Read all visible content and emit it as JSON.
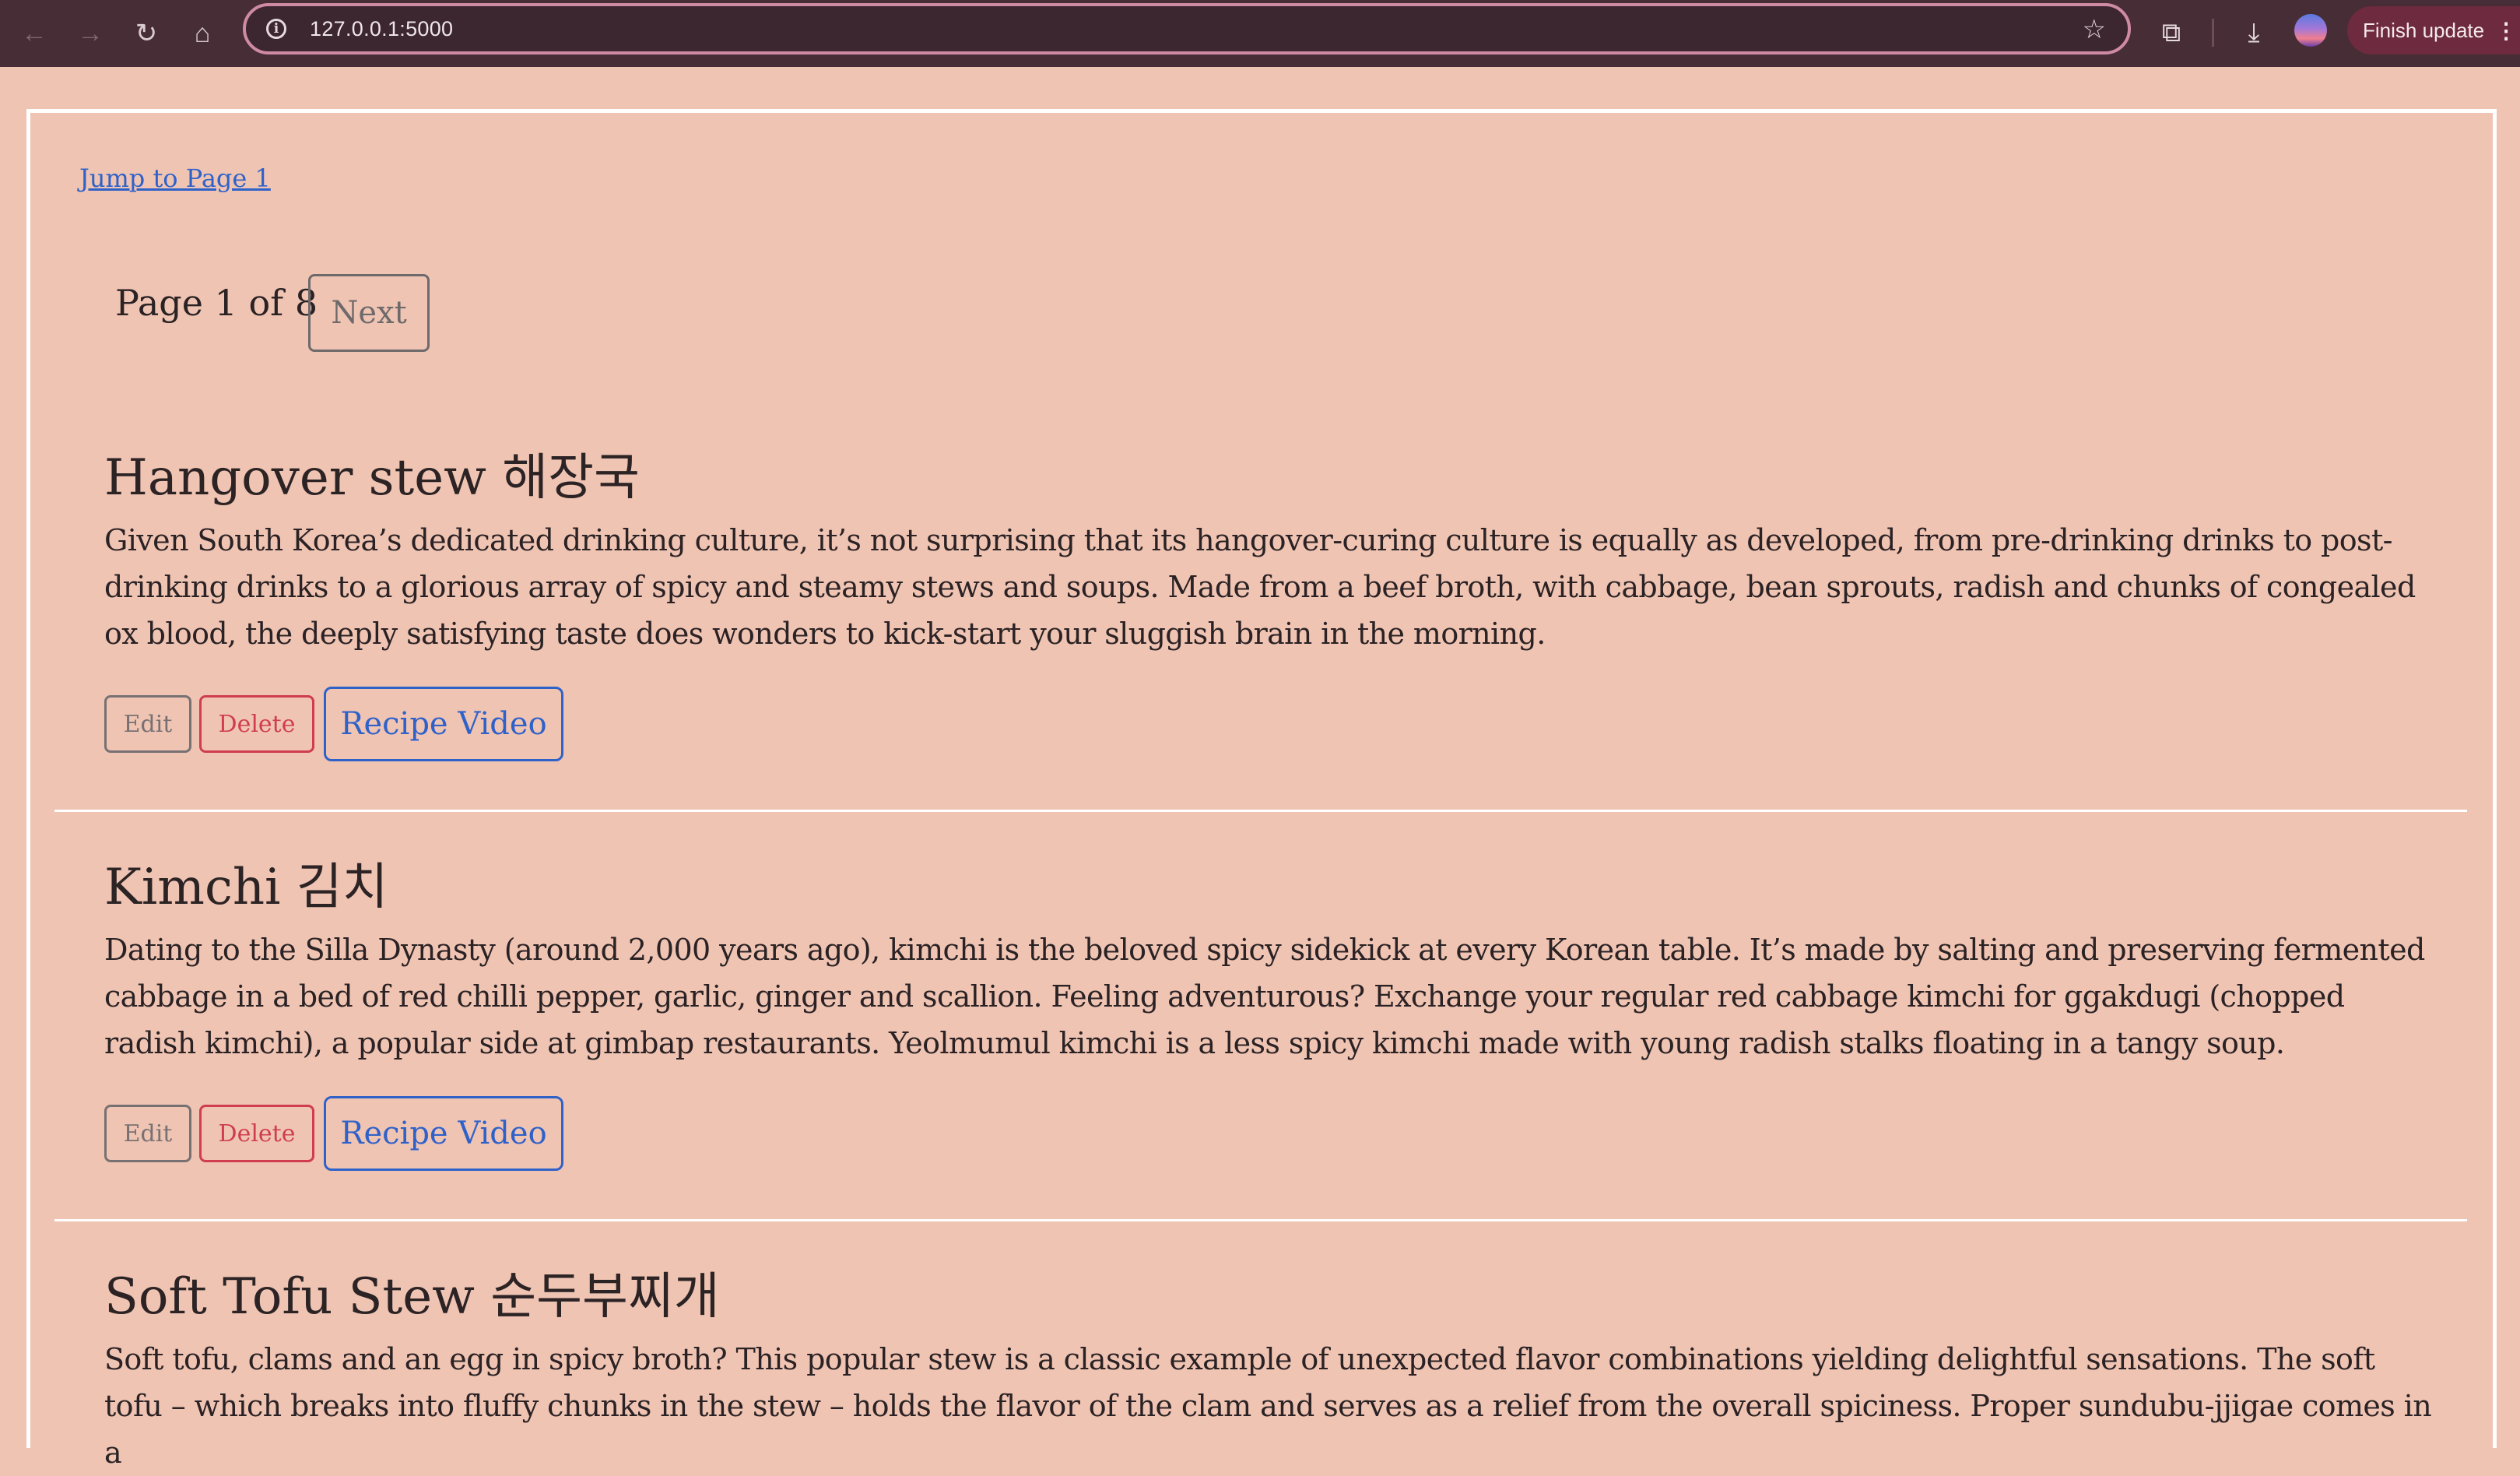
{
  "browser": {
    "url": "127.0.0.1:5000",
    "finish_update_label": "Finish update"
  },
  "page": {
    "jump_link": "Jump to Page 1",
    "pager_label": "Page 1 of 8",
    "next_label": "Next"
  },
  "recipes": [
    {
      "title": "Hangover stew 해장국",
      "description": "Given South Korea’s dedicated drinking culture, it’s not surprising that its hangover-curing culture is equally as developed, from pre-drinking drinks to post-drinking drinks to a glorious array of spicy and steamy stews and soups. Made from a beef broth, with cabbage, bean sprouts, radish and chunks of congealed ox blood, the deeply satisfying taste does wonders to kick-start your sluggish brain in the morning.",
      "edit_label": "Edit",
      "delete_label": "Delete",
      "video_label": "Recipe Video"
    },
    {
      "title": "Kimchi 김치",
      "description": "Dating to the Silla Dynasty (around 2,000 years ago), kimchi is the beloved spicy sidekick at every Korean table. It’s made by salting and preserving fermented cabbage in a bed of red chilli pepper, garlic, ginger and scallion. Feeling adventurous? Exchange your regular red cabbage kimchi for ggakdugi (chopped radish kimchi), a popular side at gimbap restaurants. Yeolmumul kimchi is a less spicy kimchi made with young radish stalks floating in a tangy soup.",
      "edit_label": "Edit",
      "delete_label": "Delete",
      "video_label": "Recipe Video"
    },
    {
      "title": "Soft Tofu Stew 순두부찌개",
      "description": "Soft tofu, clams and an egg in spicy broth? This popular stew is a classic example of unexpected flavor combinations yielding delightful sensations. The soft tofu – which breaks into fluffy chunks in the stew – holds the flavor of the clam and serves as a relief from the overall spiciness. Proper sundubu-jjigae comes in a"
    }
  ],
  "colors": {
    "page_background": "#f0c4b3",
    "chrome_background": "#472d36",
    "link_blue": "#2f62c9",
    "delete_red": "#cf3d4f"
  },
  "icons": [
    "back-icon",
    "forward-icon",
    "reload-icon",
    "home-icon",
    "info-icon",
    "star-icon",
    "extensions-icon",
    "download-icon",
    "profile-avatar",
    "more-icon"
  ]
}
